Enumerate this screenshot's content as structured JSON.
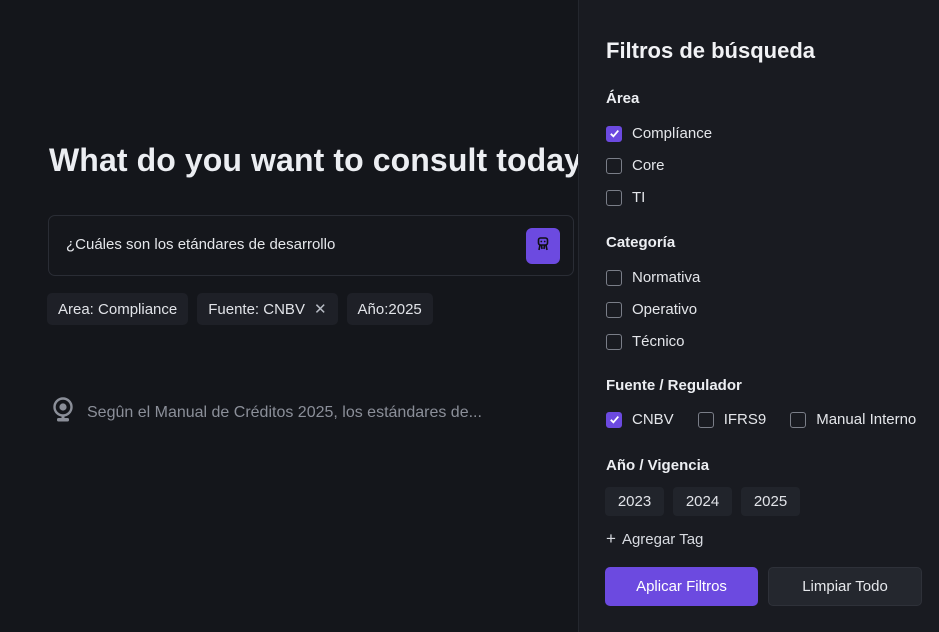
{
  "main": {
    "headline": "What do you want to consult today?",
    "search": {
      "value": "¿Cuáles son los etándares de desarrollo",
      "send_icon": "robot-icon"
    },
    "chips": [
      {
        "label": "Area: Compliance",
        "removable": false
      },
      {
        "label": "Fuente: CNBV",
        "removable": true,
        "remove_glyph": "✕"
      },
      {
        "label": "Año:2025",
        "removable": false
      }
    ],
    "answer": {
      "icon": "webcam-icon",
      "text": "Segûn el Manual de Créditos 2025, los estándares de..."
    }
  },
  "panel": {
    "title": "Filtros de búsqueda",
    "area": {
      "label": "Área",
      "options": [
        {
          "label": "Complíance",
          "checked": true
        },
        {
          "label": "Core",
          "checked": false
        },
        {
          "label": "TI",
          "checked": false
        }
      ]
    },
    "categoria": {
      "label": "Categoría",
      "options": [
        {
          "label": "Normativa",
          "checked": false
        },
        {
          "label": "Operativo",
          "checked": false
        },
        {
          "label": "Técnico",
          "checked": false
        }
      ]
    },
    "fuente": {
      "label": "Fuente / Regulador",
      "options": [
        {
          "label": "CNBV",
          "checked": true
        },
        {
          "label": "IFRS9",
          "checked": false
        },
        {
          "label": "Manual Interno",
          "checked": false
        }
      ]
    },
    "anio": {
      "label": "Año / Vigencia",
      "years": [
        "2023",
        "2024",
        "2025"
      ]
    },
    "add_tag": {
      "glyph": "+",
      "label": "Agregar Tag"
    },
    "apply_label": "Aplicar Filtros",
    "clear_label": "Limpiar Todo"
  },
  "colors": {
    "accent": "#6c4ae0",
    "background": "#14161b",
    "panel": "#191b21"
  }
}
